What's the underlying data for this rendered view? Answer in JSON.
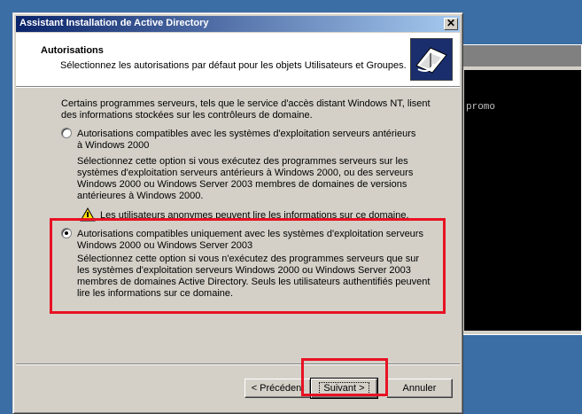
{
  "console": {
    "text": "promo"
  },
  "dialog": {
    "title": "Assistant Installation de Active Directory",
    "close_glyph": "✕",
    "header": {
      "title": "Autorisations",
      "subtitle": "Sélectionnez les autorisations par défaut pour les objets Utilisateurs et Groupes."
    },
    "intro": "Certains programmes serveurs, tels que le service d'accès distant Windows NT, lisent des informations stockées sur les contrôleurs de domaine.",
    "option1": {
      "selected": false,
      "label": "Autorisations compatibles avec les systèmes d'exploitation serveurs antérieurs à Windows 2000",
      "description": "Sélectionnez cette option si vous exécutez des programmes serveurs sur les systèmes d'exploitation serveurs antérieurs à Windows 2000, ou des serveurs Windows 2000 ou Windows Server 2003 membres de domaines de versions antérieures à Windows 2000.",
      "warning": "Les utilisateurs anonymes peuvent lire les informations sur ce domaine."
    },
    "option2": {
      "selected": true,
      "label": "Autorisations compatibles uniquement avec les systèmes d'exploitation serveurs Windows 2000 ou Windows Server 2003",
      "description": "Sélectionnez cette option si vous n'exécutez des programmes serveurs que sur les systèmes d'exploitation serveurs Windows 2000 ou Windows Server 2003 membres de domaines Active Directory. Seuls les utilisateurs authentifiés peuvent lire les informations sur ce domaine."
    },
    "buttons": {
      "back": "< Précédent",
      "next": "Suivant >",
      "cancel": "Annuler"
    }
  },
  "colors": {
    "highlight": "#e81123",
    "title_gradient_start": "#0a246a",
    "title_gradient_end": "#a6caf0",
    "desktop": "#3a6ea5"
  }
}
